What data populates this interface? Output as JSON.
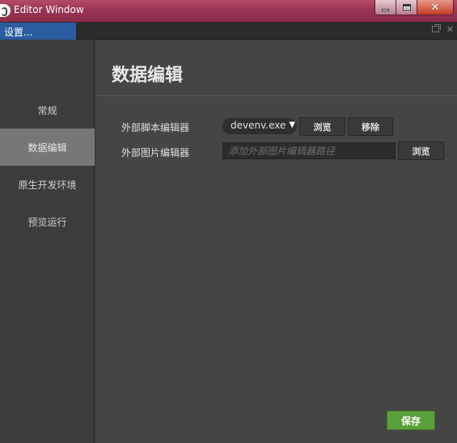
{
  "window": {
    "title": "Editor Window",
    "controls": {
      "minimize_icon": "minimize-icon",
      "maximize_icon": "maximize-icon",
      "close_icon": "close-icon"
    }
  },
  "tabs": {
    "active_label": "设置..."
  },
  "sidebar": {
    "items": [
      {
        "label": "常规",
        "active": false
      },
      {
        "label": "数据编辑",
        "active": true
      },
      {
        "label": "原生开发环境",
        "active": false
      },
      {
        "label": "预览运行",
        "active": false
      }
    ]
  },
  "main": {
    "title": "数据编辑",
    "script_editor": {
      "label": "外部脚本编辑器",
      "selected": "devenv.exe",
      "browse_label": "浏览",
      "remove_label": "移除"
    },
    "image_editor": {
      "label": "外部图片编辑器",
      "placeholder": "添加外部图片编辑器路径",
      "value": "",
      "browse_label": "浏览"
    },
    "save_label": "保存"
  },
  "colors": {
    "titlebar": "#9c3555",
    "tab_active": "#2a5ca0",
    "sidebar_active": "#777777",
    "save_button": "#5aa03a",
    "background": "#454545"
  }
}
